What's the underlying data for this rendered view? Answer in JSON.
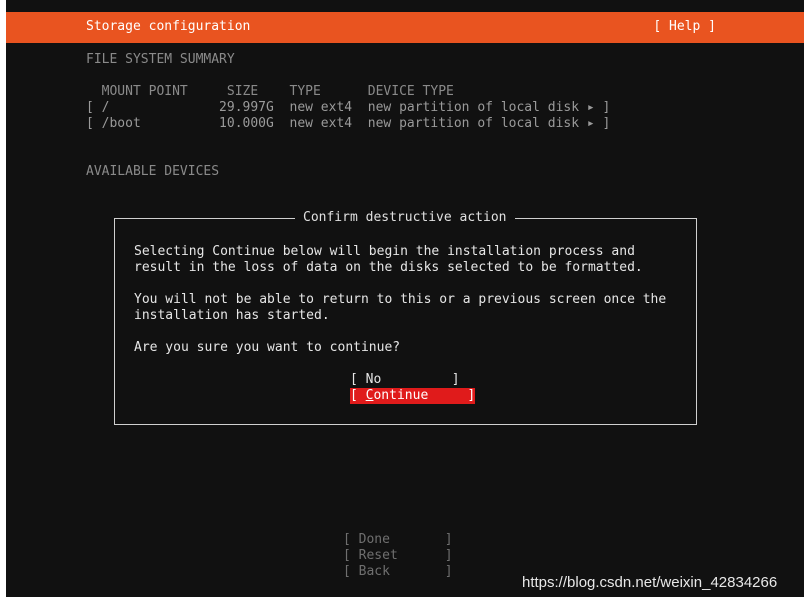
{
  "header": {
    "title": "Storage configuration",
    "help": "[ Help ]"
  },
  "summary": {
    "heading": "FILE SYSTEM SUMMARY",
    "columns": "  MOUNT POINT     SIZE    TYPE      DEVICE TYPE",
    "rows": [
      "[ /              29.997G  new ext4  new partition of local disk ▸ ]",
      "[ /boot          10.000G  new ext4  new partition of local disk ▸ ]"
    ]
  },
  "available": {
    "heading": "AVAILABLE DEVICES"
  },
  "dialog": {
    "title": "Confirm destructive action",
    "para1_line1": "Selecting Continue below will begin the installation process and",
    "para1_line2": "result in the loss of data on the disks selected to be formatted.",
    "para2_line1": "You will not be able to return to this or a previous screen once the",
    "para2_line2": "installation has started.",
    "question": "Are you sure you want to continue?",
    "no_button": "[ No         ]",
    "continue_prefix": "[ ",
    "continue_first": "C",
    "continue_rest": "ontinue     ]"
  },
  "bottom_buttons": {
    "done": "[ Done       ]",
    "reset": "[ Reset      ]",
    "back": "[ Back       ]"
  },
  "watermark": "https://blog.csdn.net/weixin_42834266",
  "colors": {
    "accent": "#e95420",
    "focus": "#e01b1b",
    "background": "#111111"
  }
}
